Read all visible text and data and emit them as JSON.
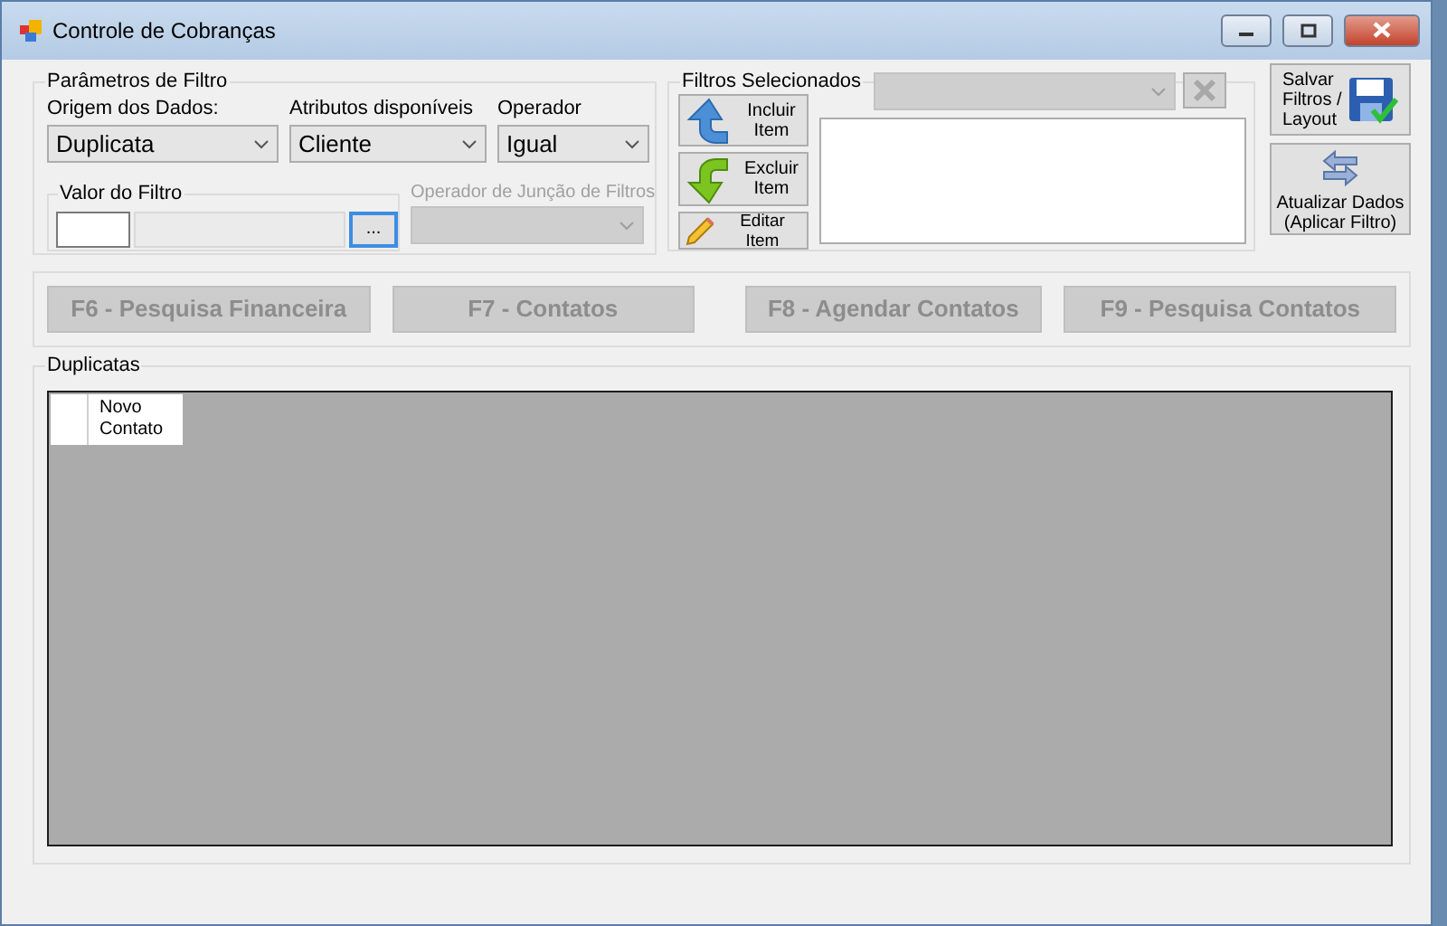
{
  "window": {
    "title": "Controle de Cobranças"
  },
  "filter_parameters": {
    "title": "Parâmetros de Filtro",
    "dropdowns": [
      {
        "label": "Origem dos Dados:",
        "value": "Duplicata"
      },
      {
        "label": "Atributos disponíveis",
        "value": "Cliente"
      },
      {
        "label": "Operador",
        "value": "Igual"
      }
    ],
    "filter_value": {
      "title": "Valor do Filtro",
      "browse_button": "..."
    },
    "junction_operator": {
      "label": "Operador de Junção de Filtros",
      "disabled": true
    }
  },
  "selected_filters": {
    "title": "Filtros Selecionados",
    "buttons": [
      {
        "kind": "include",
        "label": "Incluir Item"
      },
      {
        "kind": "exclude",
        "label": "Excluir Item"
      },
      {
        "kind": "edit",
        "label": "Editar Item"
      }
    ],
    "dropdown_disabled": true,
    "remove_disabled": true
  },
  "side_buttons": [
    {
      "kind": "save",
      "label": "Salvar Filtros / Layout"
    },
    {
      "kind": "refresh",
      "label": "Atualizar Dados (Aplicar Filtro)"
    }
  ],
  "function_buttons": [
    {
      "label": "F6 - Pesquisa Financeira",
      "disabled": true
    },
    {
      "label": "F7 - Contatos",
      "disabled": true
    },
    {
      "label": "F8 - Agendar Contatos",
      "disabled": true
    },
    {
      "label": "F9 - Pesquisa Contatos",
      "disabled": true
    }
  ],
  "grid": {
    "title": "Duplicatas",
    "columns": [
      "Novo Contato"
    ]
  }
}
